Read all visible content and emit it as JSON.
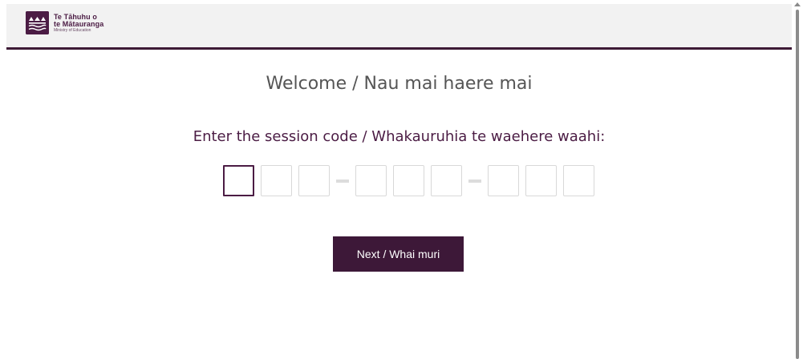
{
  "header": {
    "logo": {
      "line1": "Te Tāhuhu o",
      "line2": "te Mātauranga",
      "line3": "Ministry of Education"
    },
    "border_color": "#3d1a36"
  },
  "main": {
    "title": "Welcome / Nau mai haere mai",
    "prompt": "Enter the session code / Whakauruhia te waehere waahi:",
    "code_groups": [
      3,
      3,
      3
    ],
    "next_button_label": "Next / Whai muri"
  },
  "colors": {
    "brand": "#4b1c44",
    "button_bg": "#3d1838",
    "title_text": "#555555"
  },
  "icons": {
    "logo": "ministry-logo-icon"
  }
}
